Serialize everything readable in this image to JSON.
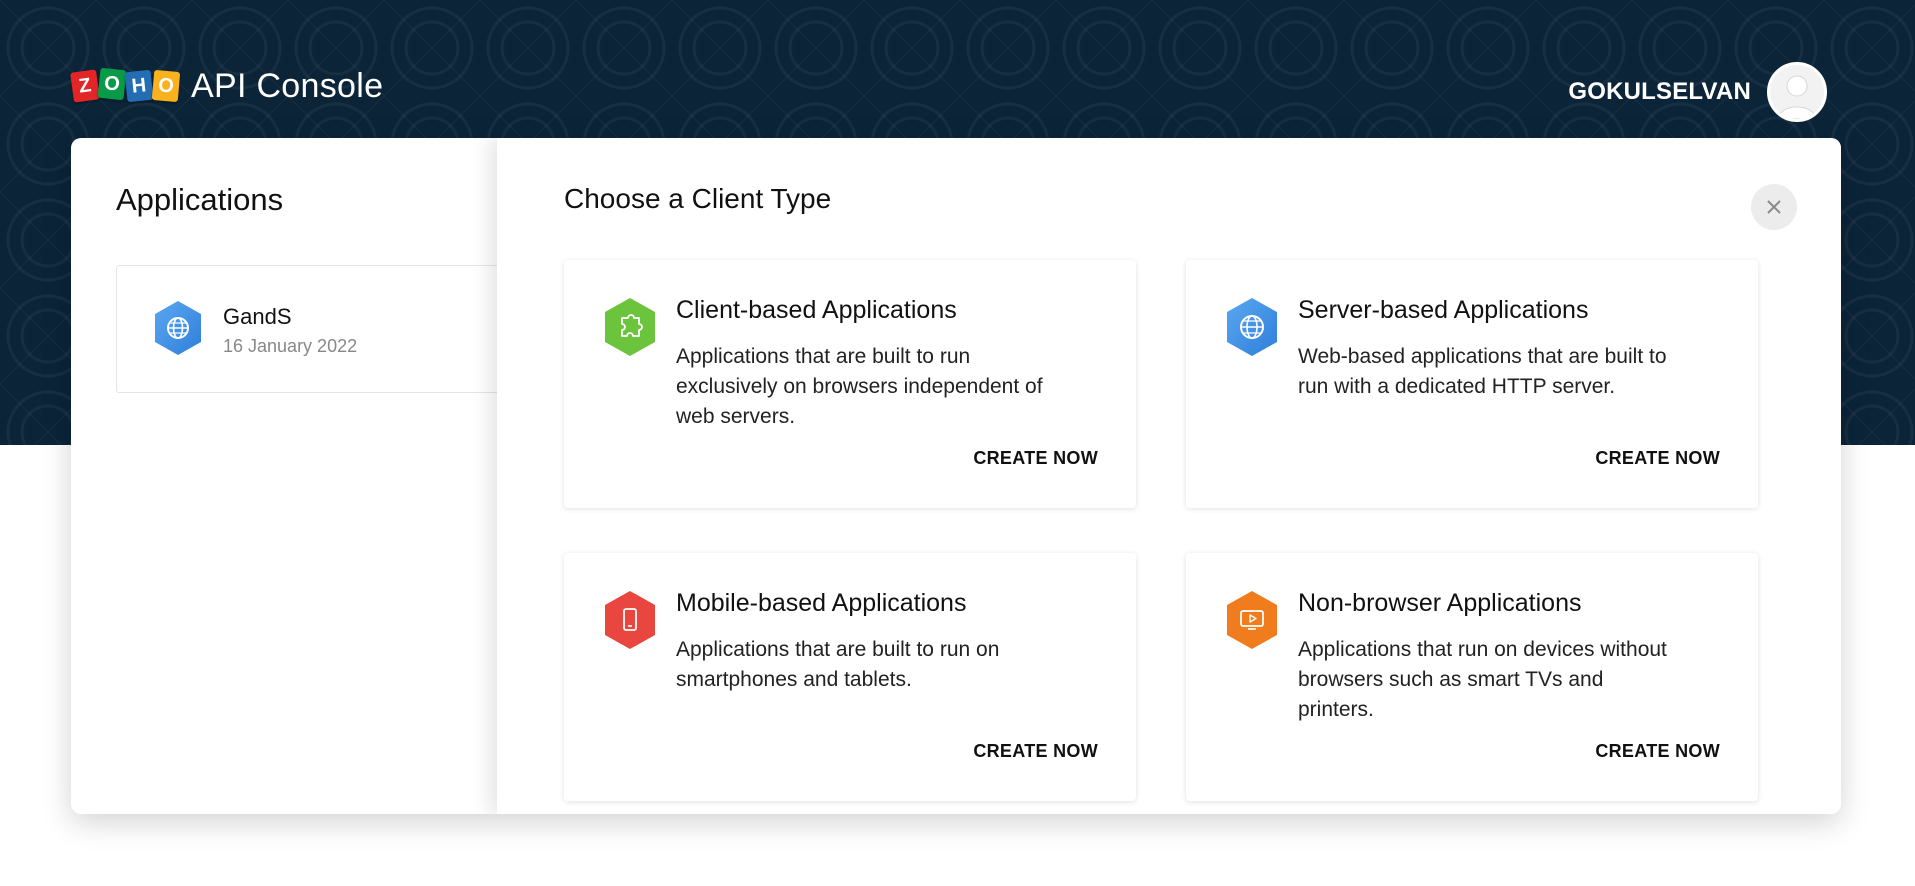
{
  "header": {
    "logo_letters": [
      "Z",
      "O",
      "H",
      "O"
    ],
    "title": "API Console",
    "user_name": "GOKULSELVAN"
  },
  "applications": {
    "title": "Applications",
    "items": [
      {
        "name": "GandS",
        "date": "16 January 2022",
        "icon": "globe-icon",
        "color": "#3d8fe6"
      }
    ]
  },
  "drawer": {
    "title": "Choose a Client Type",
    "close_icon": "close-icon",
    "cards": [
      {
        "title": "Client-based Applications",
        "description": "Applications that are built to run exclusively on browsers independent of web servers.",
        "cta": "CREATE NOW",
        "icon": "puzzle-icon",
        "color": "#6cc43c"
      },
      {
        "title": "Server-based Applications",
        "description": "Web-based applications that are built to run with a dedicated HTTP server.",
        "cta": "CREATE NOW",
        "icon": "globe-icon",
        "color": "#3d8fe6"
      },
      {
        "title": "Mobile-based Applications",
        "description": "Applications that are built to run on smartphones and tablets.",
        "cta": "CREATE NOW",
        "icon": "smartphone-icon",
        "color": "#e8463e"
      },
      {
        "title": "Non-browser Applications",
        "description": "Applications that run on devices without browsers such as smart TVs and printers.",
        "cta": "CREATE NOW",
        "icon": "monitor-icon",
        "color": "#f07c1e"
      }
    ]
  }
}
